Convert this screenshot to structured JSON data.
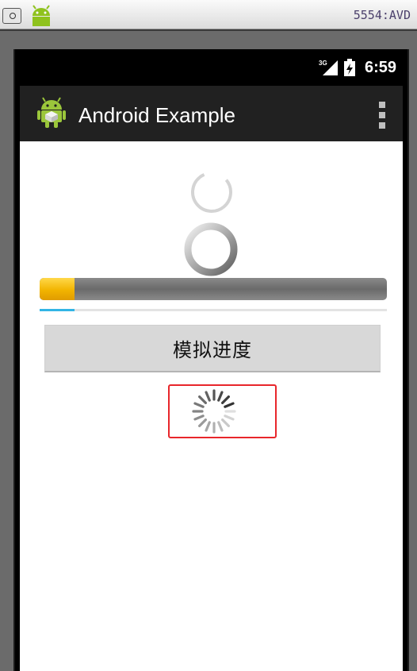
{
  "emulator": {
    "title": "5554:AVD"
  },
  "status_bar": {
    "network": "3G",
    "time": "6:59"
  },
  "action_bar": {
    "title": "Android Example"
  },
  "progress": {
    "horizontal_fraction": 0.1,
    "holo_fraction": 0.1
  },
  "button": {
    "label": "模拟进度"
  },
  "colors": {
    "accent_yellow": "#f2b400",
    "holo_blue": "#33b5e5",
    "highlight_red": "#e8262b",
    "action_bar": "#212121"
  }
}
